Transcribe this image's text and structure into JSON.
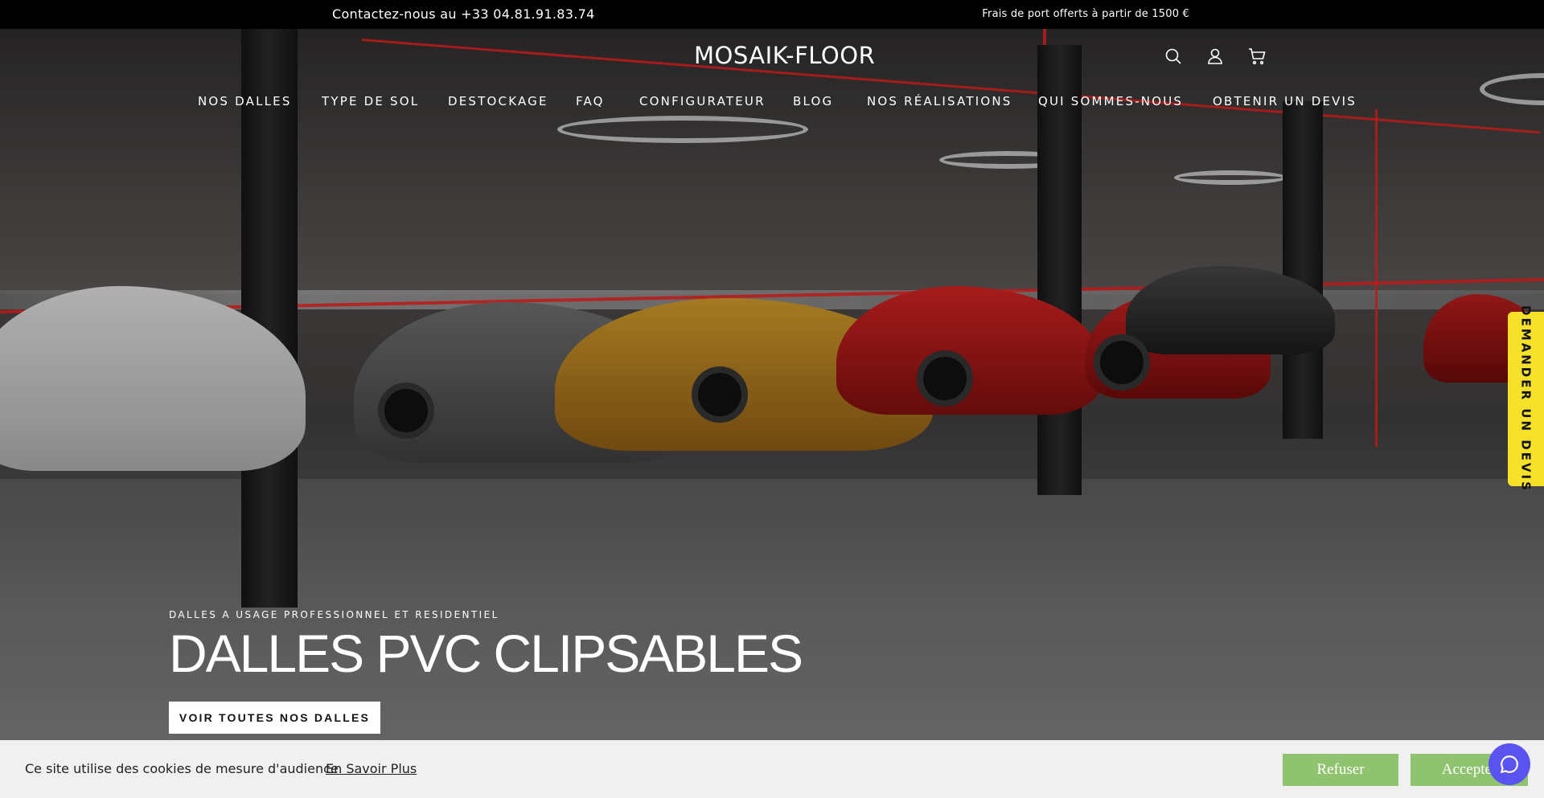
{
  "topbar": {
    "contact": "Contactez-nous au +33 04.81.91.83.74",
    "shipping": "Frais de port offerts à partir de 1500 €"
  },
  "header": {
    "logo": "MOSAIK-FLOOR",
    "icons": [
      "search-icon",
      "account-icon",
      "cart-icon"
    ]
  },
  "nav": {
    "items": [
      "NOS DALLES",
      "TYPE DE SOL",
      "DESTOCKAGE",
      "FAQ",
      "CONFIGURATEUR",
      "BLOG",
      "NOS RÉALISATIONS",
      "QUI SOMMES-NOUS",
      "OBTENIR UN DEVIS"
    ]
  },
  "hero": {
    "subtitle": "DALLES A USAGE PROFESSIONNEL ET RESIDENTIEL",
    "headline": "DALLES PVC CLIPSABLES",
    "cta": "VOIR TOUTES NOS DALLES"
  },
  "quote_tab": {
    "label": "DEMANDER UN DEVIS"
  },
  "cookie": {
    "message": "Ce site utilise des cookies de mesure d'audience.",
    "link": "En Savoir Plus",
    "refuse": "Refuser",
    "accept": "Accepter"
  },
  "chat": {
    "icon": "chat-icon"
  },
  "colors": {
    "topbar_bg": "#000000",
    "quote_tab_bg": "#f5e12a",
    "cookie_button": "#8fc370",
    "chat_button": "#5b53f0",
    "cookie_bg": "#f0f0f0"
  }
}
